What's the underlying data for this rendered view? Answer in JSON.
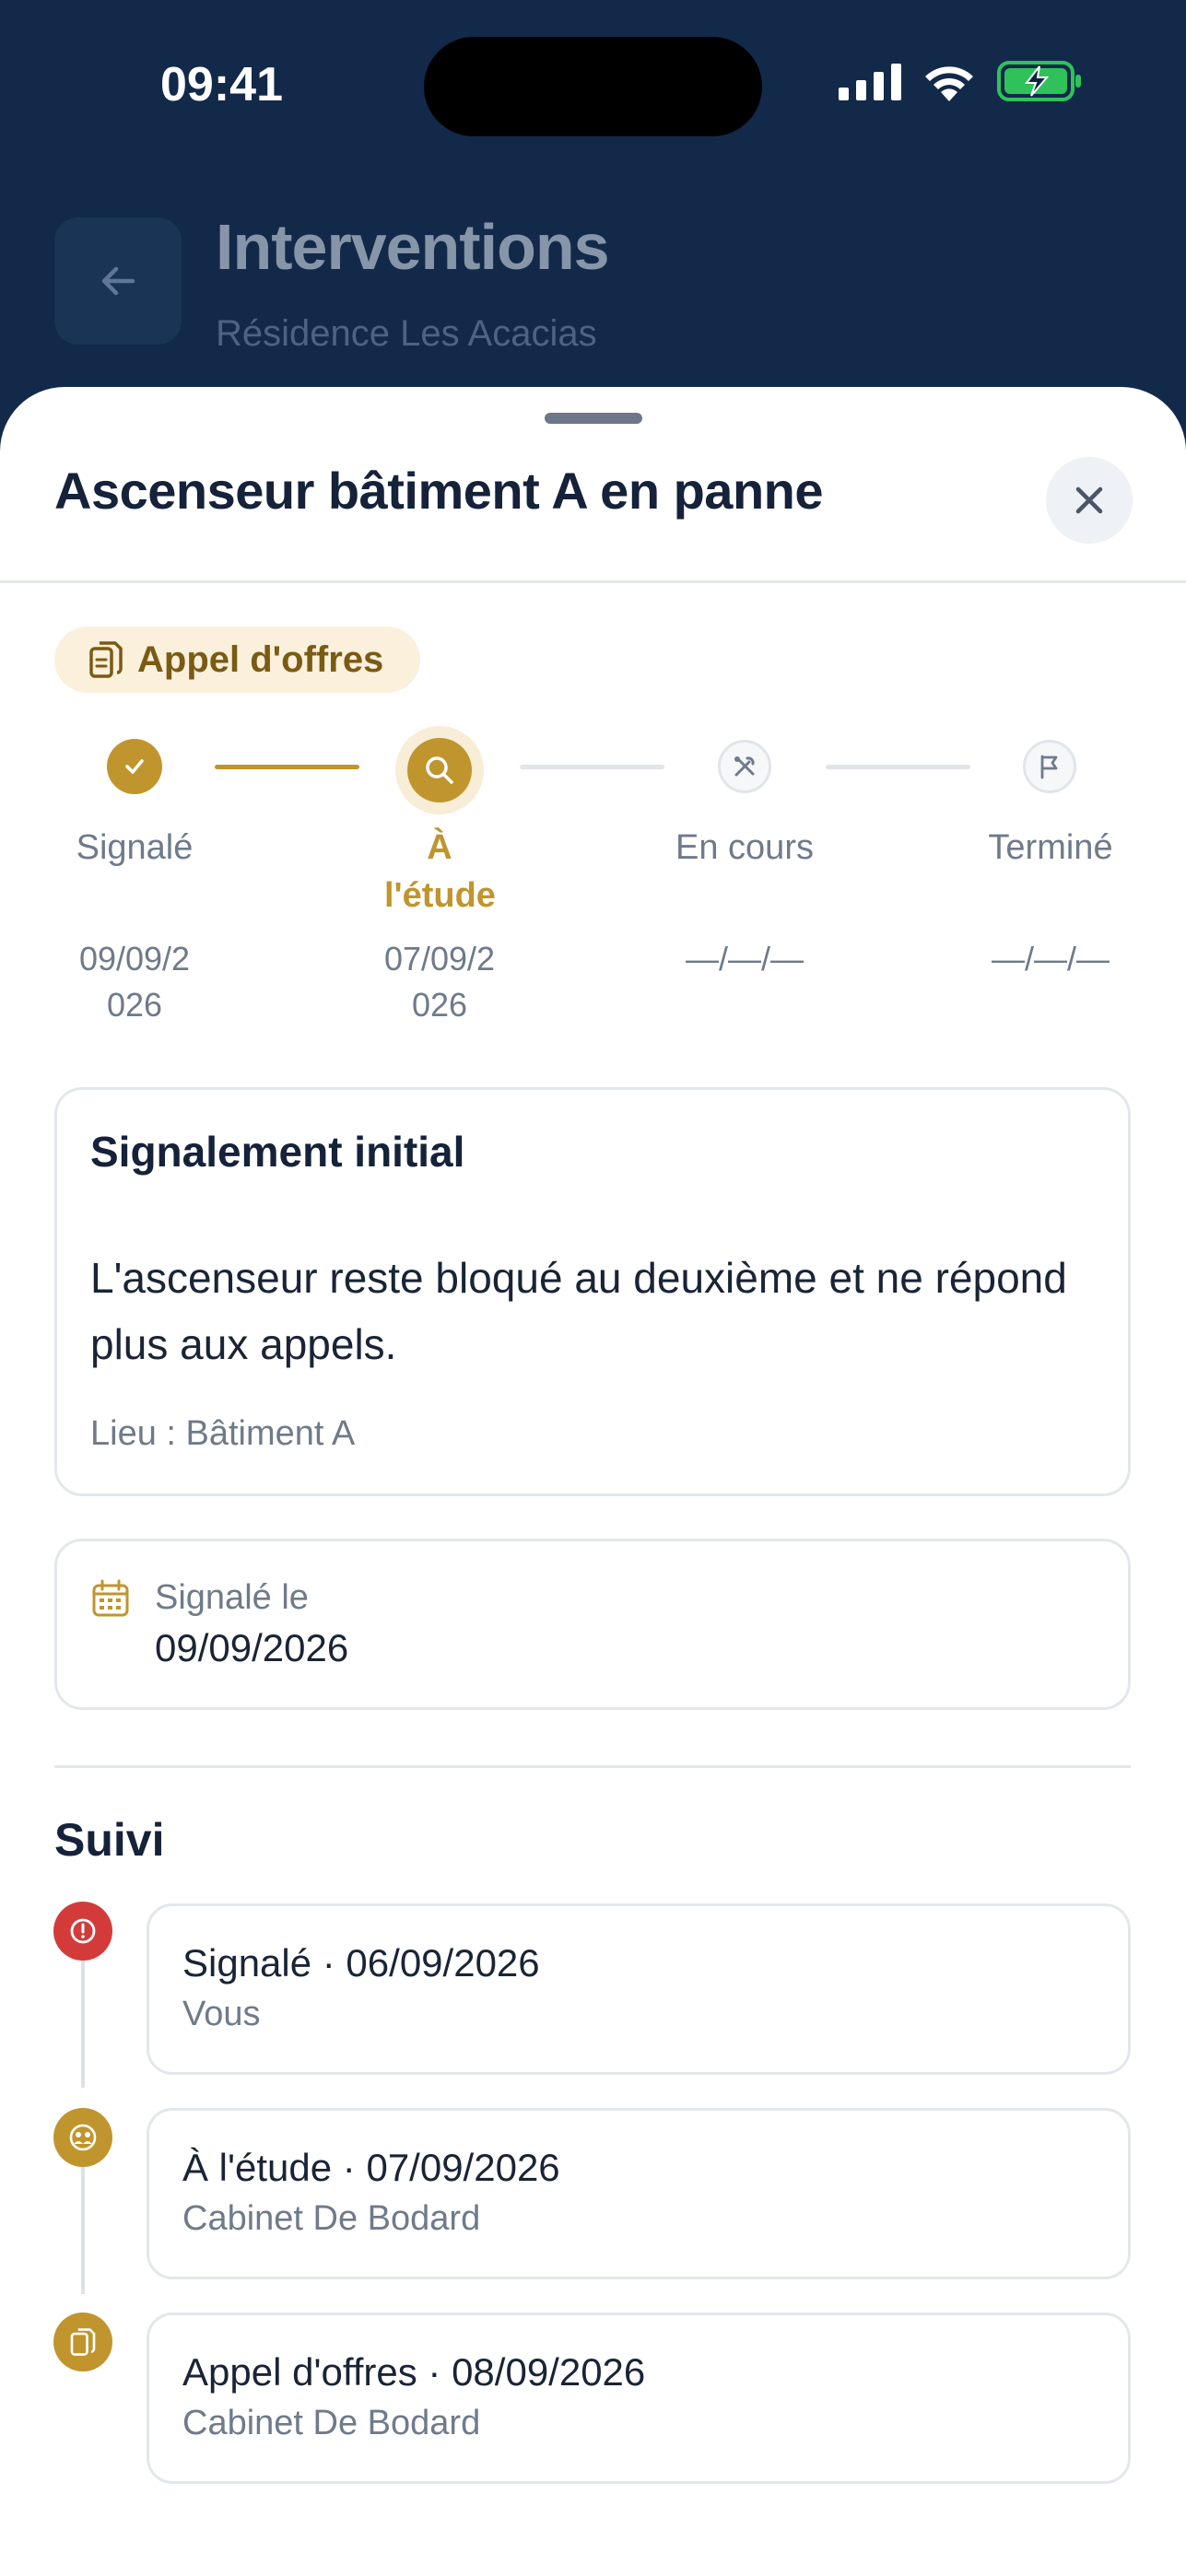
{
  "status_bar": {
    "time": "09:41"
  },
  "header": {
    "title": "Interventions",
    "subtitle": "Résidence Les Acacias"
  },
  "sheet": {
    "title": "Ascenseur bâtiment A en panne",
    "status_pill": "Appel d'offres"
  },
  "stepper": {
    "steps": [
      {
        "label": "Signalé",
        "date": "09/09/2026",
        "state": "done"
      },
      {
        "label": "À l'étude",
        "date": "07/09/2026",
        "state": "active"
      },
      {
        "label": "En cours",
        "date": "—/—/—",
        "state": "pending"
      },
      {
        "label": "Terminé",
        "date": "—/—/—",
        "state": "pending"
      }
    ]
  },
  "report": {
    "title": "Signalement initial",
    "description": "L'ascenseur reste bloqué au deuxième et ne répond plus aux appels.",
    "location": "Lieu : Bâtiment A"
  },
  "reported_date": {
    "label": "Signalé le",
    "value": "09/09/2026"
  },
  "timeline": {
    "title": "Suivi",
    "items": [
      {
        "text": "Signalé · 06/09/2026",
        "who": "Vous",
        "icon": "alert-icon",
        "color": "#d33b3b"
      },
      {
        "text": "À l'étude · 07/09/2026",
        "who": "Cabinet De Bodard",
        "icon": "people-icon",
        "color": "#c0952e"
      },
      {
        "text": "Appel d'offres · 08/09/2026",
        "who": "Cabinet De Bodard",
        "icon": "documents-icon",
        "color": "#c0952e"
      }
    ]
  },
  "colors": {
    "accent": "#c0952e",
    "navy": "#12294a",
    "alert": "#d33b3b"
  }
}
